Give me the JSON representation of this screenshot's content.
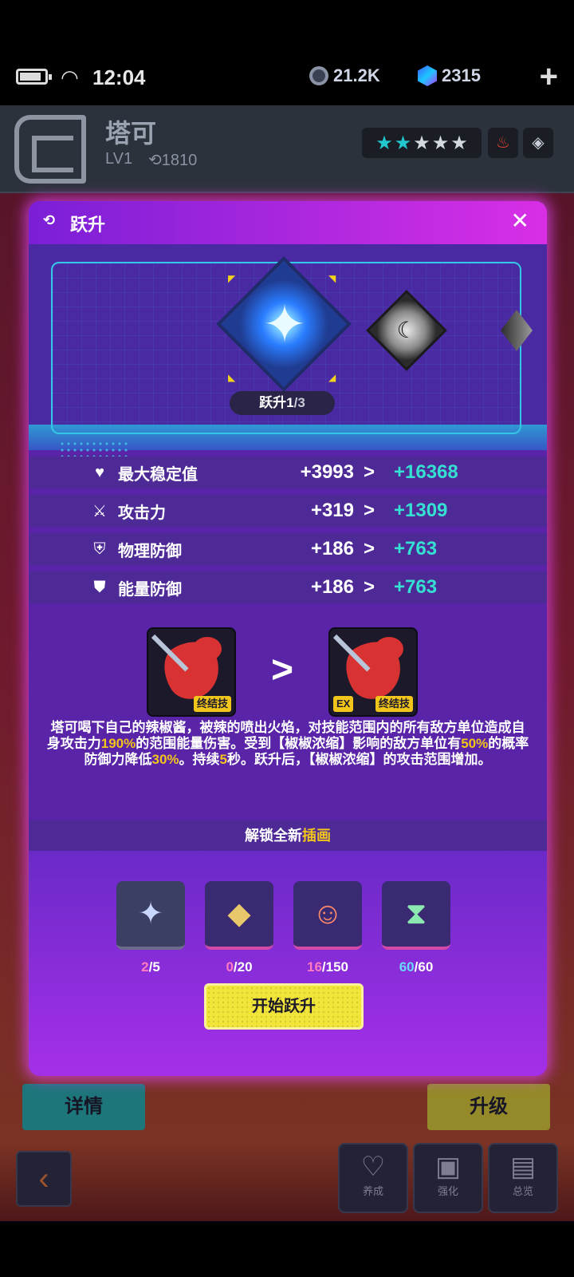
{
  "status_bar": {
    "time": "12:04",
    "coins": "21.2K",
    "gems": "2315",
    "plus": "+"
  },
  "hero": {
    "name": "塔可",
    "level": "LV1",
    "power": "1810",
    "stars_filled": 2,
    "stars_total": 5
  },
  "modal": {
    "title": "跃升",
    "close": "✕",
    "rank_label_current": "跃升1",
    "rank_label_total": "/3",
    "stats": [
      {
        "icon": "heart-pulse-icon",
        "glyph": "♥",
        "label": "最大稳定值",
        "old": "+3993",
        "new": "+16368"
      },
      {
        "icon": "sword-icon",
        "glyph": "⚔",
        "label": "攻击力",
        "old": "+319",
        "new": "+1309"
      },
      {
        "icon": "shield-exclaim-icon",
        "glyph": "⛨",
        "label": "物理防御",
        "old": "+186",
        "new": "+763"
      },
      {
        "icon": "shield-bolt-icon",
        "glyph": "⛊",
        "label": "能量防御",
        "old": "+186",
        "new": "+763"
      }
    ],
    "stat_arrow": ">",
    "skill_tag": "终结技",
    "skill_ex": "EX",
    "skill_arrow": ">",
    "skill_desc": {
      "p1": "塔可喝下自己的辣椒酱，被辣的喷出火焰，对技能范围内的所有敌方单位造成自身攻击力",
      "v1": "190%",
      "p2": "的范围能量伤害。受到【椒椒浓缩】影响的敌方单位有",
      "v2": "50%",
      "p3": "的概率防御力降低",
      "v3": "30%",
      "p4": "。持续",
      "v4": "5",
      "p5": "秒。跃升后，【椒椒浓缩】的攻击范围增加。"
    },
    "unlock_prefix": "解锁全新",
    "unlock_highlight": "插画",
    "materials": [
      {
        "icon": "sparkle-stars-icon",
        "glyph": "✦",
        "current": "2",
        "required": "/5"
      },
      {
        "icon": "prism-crystal-icon",
        "glyph": "◆",
        "current": "0",
        "required": "/20"
      },
      {
        "icon": "hero-portrait-icon",
        "glyph": "☺",
        "current": "16",
        "required": "/150"
      },
      {
        "icon": "hourglass-icon",
        "glyph": "⧗",
        "current": "60",
        "required": "/60"
      }
    ],
    "start_button": "开始跃升"
  },
  "background": {
    "details_button": "详情",
    "upgrade_button": "升级",
    "nav": [
      {
        "label": "养成",
        "glyph": "♡"
      },
      {
        "label": "强化",
        "glyph": "▣"
      },
      {
        "label": "总览",
        "glyph": "▤"
      }
    ],
    "back_glyph": "‹"
  }
}
